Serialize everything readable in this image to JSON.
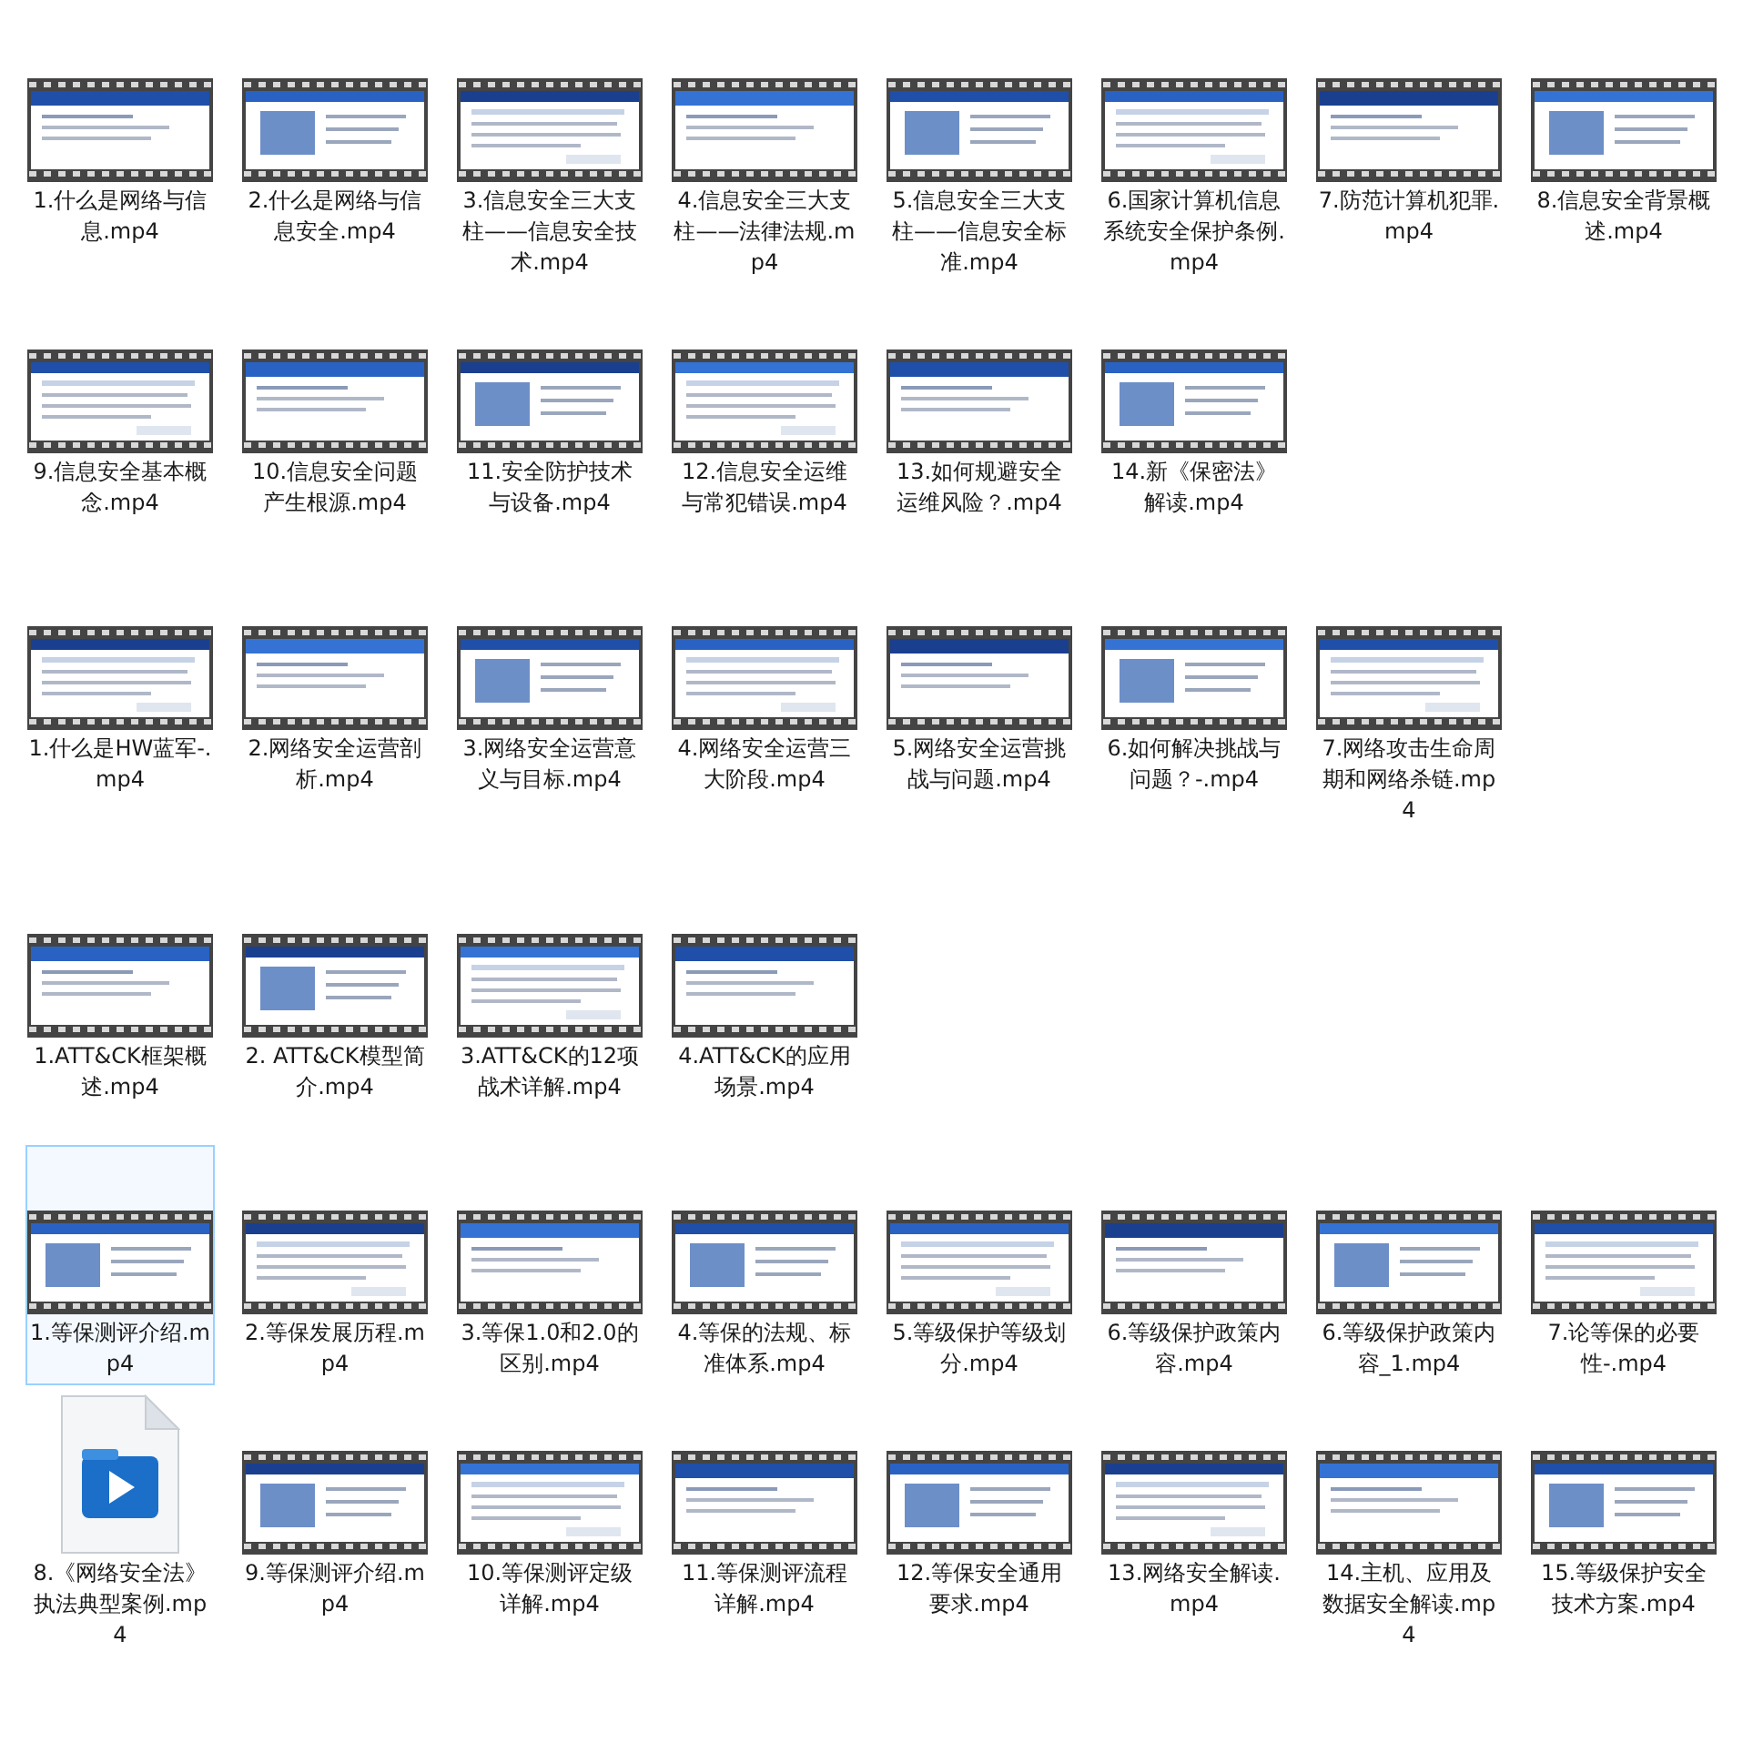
{
  "groups": [
    {
      "items": [
        {
          "label": "1.什么是网络与信息.mp4",
          "kind": "video",
          "selected": false
        },
        {
          "label": "2.什么是网络与信息安全.mp4",
          "kind": "video",
          "selected": false
        },
        {
          "label": "3.信息安全三大支柱——信息安全技术.mp4",
          "kind": "video",
          "selected": false
        },
        {
          "label": "4.信息安全三大支柱——法律法规.mp4",
          "kind": "video",
          "selected": false
        },
        {
          "label": "5.信息安全三大支柱——信息安全标准.mp4",
          "kind": "video",
          "selected": false
        },
        {
          "label": "6.国家计算机信息系统安全保护条例.mp4",
          "kind": "video",
          "selected": false
        },
        {
          "label": "7.防范计算机犯罪.mp4",
          "kind": "video",
          "selected": false
        },
        {
          "label": "8.信息安全背景概述.mp4",
          "kind": "video",
          "selected": false
        },
        {
          "label": "9.信息安全基本概念.mp4",
          "kind": "video",
          "selected": false
        },
        {
          "label": "10.信息安全问题产生根源.mp4",
          "kind": "video",
          "selected": false
        },
        {
          "label": "11.安全防护技术与设备.mp4",
          "kind": "video",
          "selected": false
        },
        {
          "label": "12.信息安全运维与常犯错误.mp4",
          "kind": "video",
          "selected": false
        },
        {
          "label": "13.如何规避安全运维风险？.mp4",
          "kind": "video",
          "selected": false
        },
        {
          "label": "14.新《保密法》解读.mp4",
          "kind": "video",
          "selected": false
        }
      ]
    },
    {
      "items": [
        {
          "label": "1.什么是HW蓝军-.mp4",
          "kind": "video",
          "selected": false
        },
        {
          "label": "2.网络安全运营剖析.mp4",
          "kind": "video",
          "selected": false
        },
        {
          "label": "3.网络安全运营意义与目标.mp4",
          "kind": "video",
          "selected": false
        },
        {
          "label": "4.网络安全运营三大阶段.mp4",
          "kind": "video",
          "selected": false
        },
        {
          "label": "5.网络安全运营挑战与问题.mp4",
          "kind": "video",
          "selected": false
        },
        {
          "label": "6.如何解决挑战与问题？-.mp4",
          "kind": "video",
          "selected": false
        },
        {
          "label": "7.网络攻击生命周期和网络杀链.mp4",
          "kind": "video",
          "selected": false
        }
      ]
    },
    {
      "items": [
        {
          "label": "1.ATT&CK框架概述.mp4",
          "kind": "video",
          "selected": false
        },
        {
          "label": "2.  ATT&CK模型简介.mp4",
          "kind": "video",
          "selected": false
        },
        {
          "label": "3.ATT&CK的12项战术详解.mp4",
          "kind": "video",
          "selected": false
        },
        {
          "label": "4.ATT&CK的应用场景.mp4",
          "kind": "video",
          "selected": false
        }
      ]
    },
    {
      "items": [
        {
          "label": "1.等保测评介绍.mp4",
          "kind": "video",
          "selected": true
        },
        {
          "label": "2.等保发展历程.mp4",
          "kind": "video",
          "selected": false
        },
        {
          "label": "3.等保1.0和2.0的区别.mp4",
          "kind": "video",
          "selected": false
        },
        {
          "label": "4.等保的法规、标准体系.mp4",
          "kind": "video",
          "selected": false
        },
        {
          "label": "5.等级保护等级划分.mp4",
          "kind": "video",
          "selected": false
        },
        {
          "label": "6.等级保护政策内容.mp4",
          "kind": "video",
          "selected": false
        },
        {
          "label": "6.等级保护政策内容_1.mp4",
          "kind": "video",
          "selected": false
        },
        {
          "label": "7.论等保的必要性-.mp4",
          "kind": "video",
          "selected": false
        },
        {
          "label": "8.《网络安全法》执法典型案例.mp4",
          "kind": "file",
          "selected": false
        },
        {
          "label": "9.等保测评介绍.mp4",
          "kind": "video",
          "selected": false
        },
        {
          "label": "10.等保测评定级详解.mp4",
          "kind": "video",
          "selected": false
        },
        {
          "label": "11.等保测评流程详解.mp4",
          "kind": "video",
          "selected": false
        },
        {
          "label": "12.等保安全通用要求.mp4",
          "kind": "video",
          "selected": false
        },
        {
          "label": "13.网络安全解读.mp4",
          "kind": "video",
          "selected": false
        },
        {
          "label": "14.主机、应用及数据安全解读.mp4",
          "kind": "video",
          "selected": false
        },
        {
          "label": "15.等级保护安全技术方案.mp4",
          "kind": "video",
          "selected": false
        }
      ]
    }
  ]
}
